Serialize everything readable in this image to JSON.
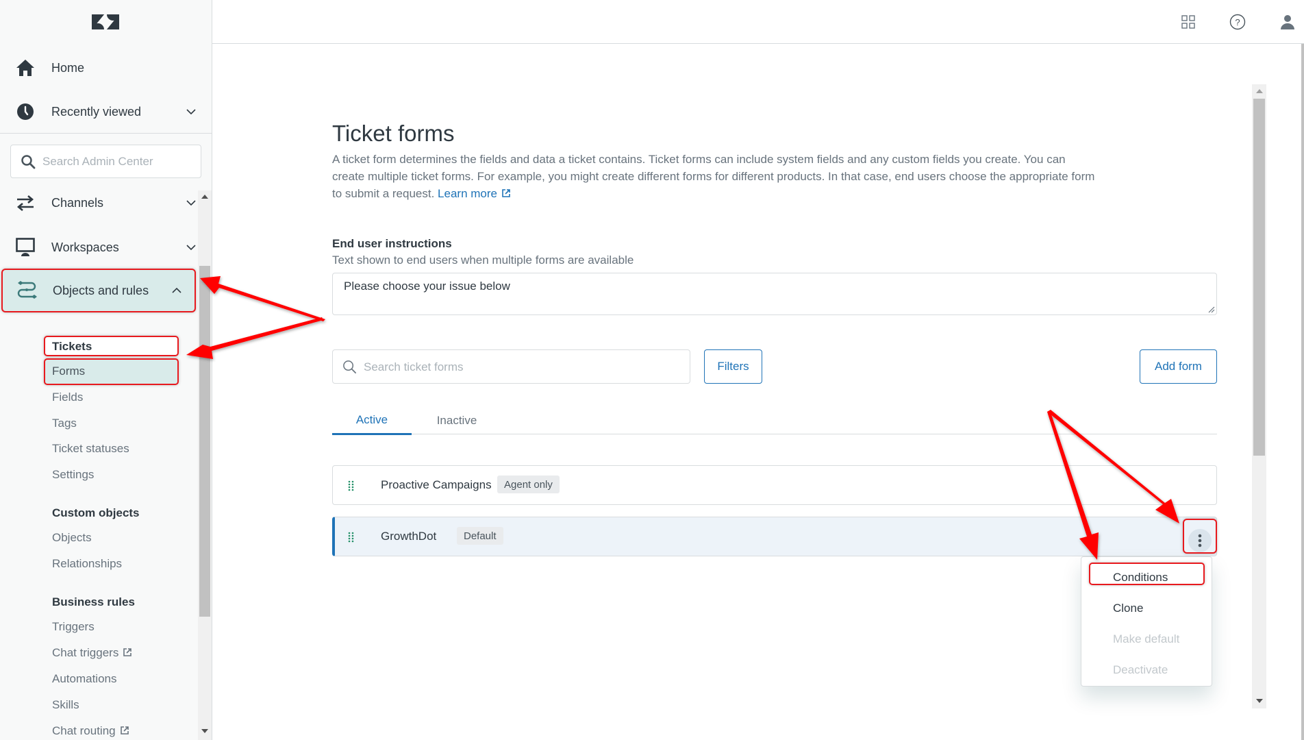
{
  "sidebar": {
    "logo": "zendesk-logo",
    "home": "Home",
    "recently_viewed": "Recently viewed",
    "search_placeholder": "Search Admin Center",
    "channels": "Channels",
    "workspaces": "Workspaces",
    "objects_and_rules": "Objects and rules",
    "tickets_heading": "Tickets",
    "ticket_items": [
      "Forms",
      "Fields",
      "Tags",
      "Ticket statuses",
      "Settings"
    ],
    "custom_objects_heading": "Custom objects",
    "custom_objects_items": [
      "Objects",
      "Relationships"
    ],
    "business_rules_heading": "Business rules",
    "business_rules_items": [
      "Triggers",
      "Chat triggers",
      "Automations",
      "Skills",
      "Chat routing"
    ]
  },
  "topbar": {
    "icons": [
      "products-grid-icon",
      "help-icon",
      "user-icon"
    ]
  },
  "main": {
    "title": "Ticket forms",
    "description": "A ticket form determines the fields and data a ticket contains. Ticket forms can include system fields and any custom fields you create. You can create multiple ticket forms. For example, you might create different forms for different products. In that case, end users choose the appropriate form to submit a request.",
    "learn_more": "Learn more",
    "instructions_label": "End user instructions",
    "instructions_hint": "Text shown to end users when multiple forms are available",
    "instructions_value": "Please choose your issue below",
    "search_placeholder": "Search ticket forms",
    "filters_label": "Filters",
    "add_form_label": "Add form",
    "tabs": [
      {
        "label": "Active",
        "active": true
      },
      {
        "label": "Inactive",
        "active": false
      }
    ],
    "forms": [
      {
        "name": "Proactive Campaigns",
        "badge": "Agent only"
      },
      {
        "name": "GrowthDot",
        "badge": "Default"
      }
    ],
    "menu": [
      {
        "label": "Conditions",
        "enabled": true
      },
      {
        "label": "Clone",
        "enabled": true
      },
      {
        "label": "Make default",
        "enabled": false
      },
      {
        "label": "Deactivate",
        "enabled": false
      }
    ]
  },
  "colors": {
    "accent": "#1f73b7",
    "annotation": "#e8191e",
    "selected_nav": "#d9ebea"
  }
}
